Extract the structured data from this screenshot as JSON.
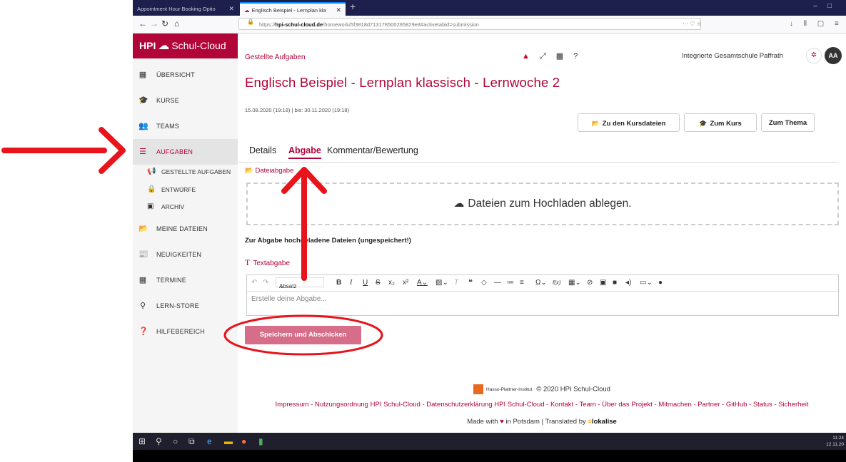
{
  "browser": {
    "tabs": [
      {
        "title": "Appointment Hour Booking Optio",
        "active": false
      },
      {
        "title": "Englisch Beispiel - Lernplan kla",
        "active": true
      }
    ],
    "url_prefix": "https://",
    "url_host": "hpi-schul-cloud.de",
    "url_path": "/homework/5f3818d713178500295829e8#activetabid=submission"
  },
  "sidebar": {
    "logo_hpi": "HPI",
    "logo_text": "Schul-Cloud",
    "items": [
      {
        "label": "ÜBERSICHT",
        "icon": "dashboard-icon"
      },
      {
        "label": "KURSE",
        "icon": "graduation-cap-icon"
      },
      {
        "label": "TEAMS",
        "icon": "users-icon"
      },
      {
        "label": "AUFGABEN",
        "icon": "tasks-icon",
        "active": true
      },
      {
        "label": "MEINE DATEIEN",
        "icon": "folder-icon"
      },
      {
        "label": "NEUIGKEITEN",
        "icon": "newspaper-icon"
      },
      {
        "label": "TERMINE",
        "icon": "calendar-icon"
      },
      {
        "label": "LERN-STORE",
        "icon": "search-icon"
      },
      {
        "label": "HILFEBEREICH",
        "icon": "question-icon"
      }
    ],
    "subitems": [
      {
        "label": "GESTELLTE AUFGABEN",
        "icon": "megaphone-icon"
      },
      {
        "label": "ENTWÜRFE",
        "icon": "lock-icon"
      },
      {
        "label": "ARCHIV",
        "icon": "archive-icon"
      }
    ]
  },
  "header": {
    "breadcrumb": "Gestellte Aufgaben",
    "school": "Integrierte Gesamtschule Paffrath",
    "avatar_initials": "AA"
  },
  "task": {
    "title": "Englisch Beispiel - Lernplan klassisch - Lernwoche 2",
    "dates": "15.08.2020 (19:18) | bis: 30.11.2020 (19:18)",
    "buttons": {
      "files": "Zu den Kursdateien",
      "course": "Zum Kurs",
      "topic": "Zum Thema"
    },
    "tabs": [
      "Details",
      "Abgabe",
      "Kommentar/Bewertung"
    ],
    "active_tab": "Abgabe"
  },
  "submission": {
    "file_header": "Dateiabgabe",
    "dropzone_text": "Dateien zum Hochladen ablegen.",
    "uploaded_header": "Zur Abgabe hochgeladene Dateien (ungespeichert!)",
    "text_header": "Textabgabe",
    "format_select": "Absatz",
    "editor_placeholder": "Erstelle deine Abgabe...",
    "submit_label": "Speichern und Abschicken"
  },
  "footer": {
    "hpi_label": "Hasso-Plattner-Institut",
    "copyright": "© 2020 HPI Schul-Cloud",
    "links": "Impressum - Nutzungsordnung HPI Schul-Cloud - Datenschutzerklärung HPI Schul-Cloud - Kontakt - Team - Über das Projekt - Mitmachen - Partner - GitHub - Status - Sicherheit",
    "made_with": "Made with",
    "in_potsdam": "in Potsdam | Translated by",
    "lokalise": "lokalise"
  },
  "taskbar": {
    "time": "11:24",
    "date": "12.11.20"
  },
  "colors": {
    "brand": "#b10438",
    "annotation": "#e8131b",
    "submit": "#d66e8a"
  }
}
